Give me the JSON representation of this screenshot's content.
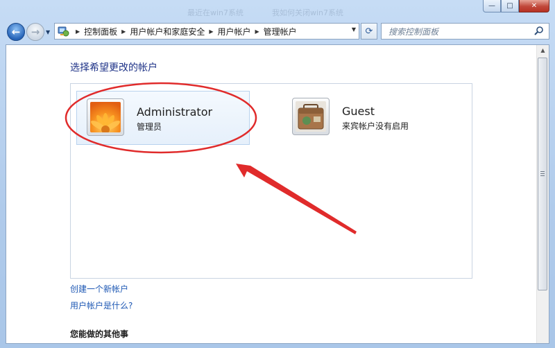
{
  "window": {
    "ghost_titles": [
      "最近在win7系统",
      "我如何关闭win7系统"
    ],
    "controls": {
      "minimize_glyph": "—",
      "maximize_glyph": "□",
      "close_glyph": "✕"
    }
  },
  "nav": {
    "back_glyph": "←",
    "forward_glyph": "→",
    "history_glyph": "▼",
    "refresh_glyph": "⟳",
    "breadcrumbs": [
      "控制面板",
      "用户帐户和家庭安全",
      "用户帐户",
      "管理帐户"
    ],
    "search_placeholder": "搜索控制面板"
  },
  "main": {
    "heading": "选择希望更改的帐户",
    "accounts": [
      {
        "name": "Administrator",
        "type": "管理员"
      },
      {
        "name": "Guest",
        "type": "来宾帐户没有启用"
      }
    ],
    "links": [
      "创建一个新帐户",
      "用户帐户是什么?"
    ],
    "other_heading": "您能做的其他事"
  },
  "colors": {
    "heading": "#1e3287",
    "link": "#1e58b4",
    "annotation": "#e02b2b",
    "selected_bg": "#e6f0fb"
  },
  "icons": [
    "control-panel-icon",
    "search-icon",
    "user-picture-flower",
    "user-picture-suitcase"
  ]
}
